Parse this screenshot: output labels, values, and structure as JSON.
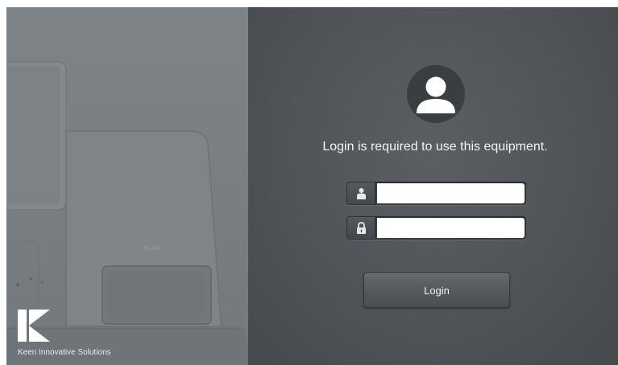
{
  "brand": {
    "name": "Keen Innovative Solutions",
    "logo_icon": "k-logo-icon",
    "device_label": "KLAB"
  },
  "login": {
    "message": "Login is required to use this equipment.",
    "avatar_icon": "user-avatar-icon",
    "username": {
      "icon": "user-icon",
      "value": "",
      "placeholder": ""
    },
    "password": {
      "icon": "lock-icon",
      "value": "",
      "placeholder": ""
    },
    "button_label": "Login"
  },
  "colors": {
    "left_panel": "#7a7f83",
    "right_panel": "#505357",
    "text": "#f3f3f3",
    "input_bg": "#ffffff"
  }
}
